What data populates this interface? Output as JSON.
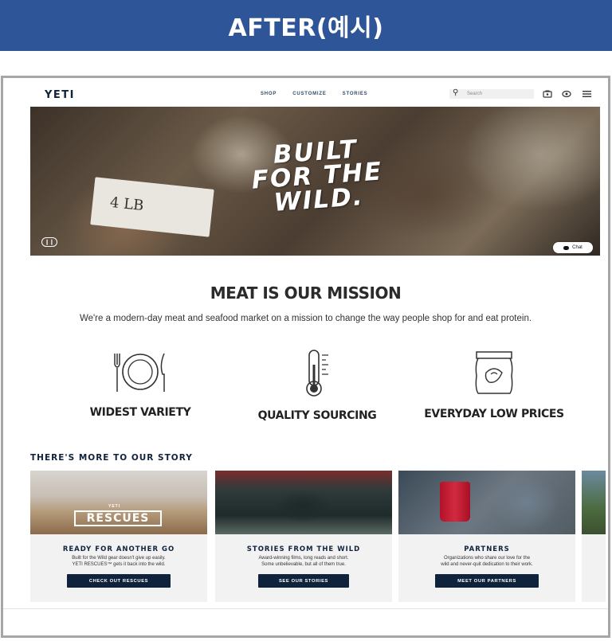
{
  "banner": {
    "title": "AFTER(예시)"
  },
  "nav": {
    "logo": "YETI",
    "menu": [
      "SHOP",
      "CUSTOMIZE",
      "STORIES"
    ],
    "search_placeholder": "Search",
    "icons": [
      "search-icon",
      "cart-icon",
      "account-icon",
      "hamburger-menu-icon"
    ]
  },
  "hero": {
    "title_lines": [
      "BUILT",
      "FOR THE",
      "WILD."
    ],
    "sign_text": "4 LB",
    "chat_label": "Chat"
  },
  "mission": {
    "title": "MEAT IS OUR MISSION",
    "subtitle": "We're a modern-day meat and seafood market on a mission to change the way people shop for and eat protein."
  },
  "features": [
    {
      "label": "WIDEST VARIETY",
      "icon": "plate-cutlery-icon"
    },
    {
      "label": "QUALITY SOURCING",
      "icon": "thermometer-icon"
    },
    {
      "label": "EVERYDAY LOW PRICES",
      "icon": "package-icon"
    }
  ],
  "story": {
    "heading": "THERE'S MORE TO OUR STORY",
    "cards": [
      {
        "image_text": "RESCUES",
        "image_brand": "YETI",
        "title": "READY FOR ANOTHER GO",
        "desc_lines": [
          "Built for the Wild gear doesn't give up easily.",
          "YETI RESCUES™ gets it back into the wild."
        ],
        "button": "CHECK OUT RESCUES"
      },
      {
        "title": "STORIES FROM THE WILD",
        "desc_lines": [
          "Award-winning films, long reads and short.",
          "Some unbelievable, but all of them true."
        ],
        "button": "SEE OUR STORIES"
      },
      {
        "title": "PARTNERS",
        "desc_lines": [
          "Organizations who share our love for the",
          "wild and never-quit dedication to their work."
        ],
        "button": "MEET OUR PARTNERS"
      }
    ]
  }
}
